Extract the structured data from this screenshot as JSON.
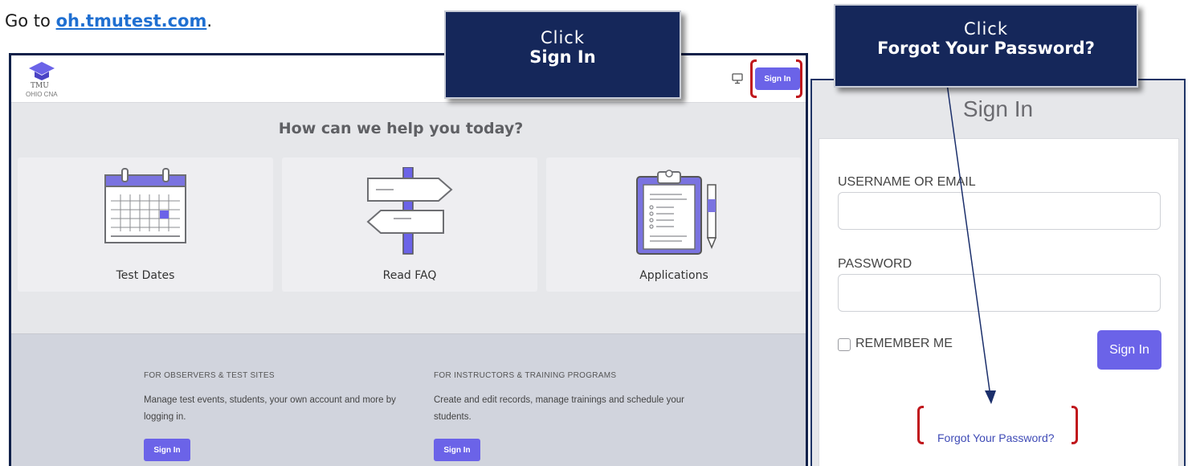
{
  "instruction": {
    "prefix": "Go to ",
    "link": "oh.tmutest.com",
    "suffix": "."
  },
  "callouts": {
    "signin": {
      "line1": "Click",
      "line2": "Sign In"
    },
    "forgot": {
      "line1": "Click",
      "line2": "Forgot Your Password?"
    }
  },
  "site": {
    "logo_main": "TMU",
    "logo_sub": "OHIO CNA",
    "header_signin": "Sign In",
    "help_title": "How can we help you today?",
    "cards": [
      {
        "label": "Test Dates"
      },
      {
        "label": "Read FAQ"
      },
      {
        "label": "Applications"
      }
    ],
    "observers": {
      "heading": "FOR OBSERVERS & TEST SITES",
      "text": "Manage test events, students, your own account and more by logging in.",
      "button": "Sign In"
    },
    "instructors": {
      "heading": "FOR INSTRUCTORS & TRAINING PROGRAMS",
      "text": "Create and edit records, manage trainings and schedule your students.",
      "button": "Sign In"
    }
  },
  "signin_form": {
    "title": "Sign In",
    "username_label": "USERNAME OR EMAIL",
    "password_label": "PASSWORD",
    "remember_label": "REMEMBER ME",
    "submit": "Sign In",
    "forgot": "Forgot Your Password?"
  },
  "colors": {
    "accent": "#6b63e8",
    "callout_bg": "#15275a",
    "highlight_red": "#c0161c",
    "link_blue": "#1f6fd1"
  }
}
